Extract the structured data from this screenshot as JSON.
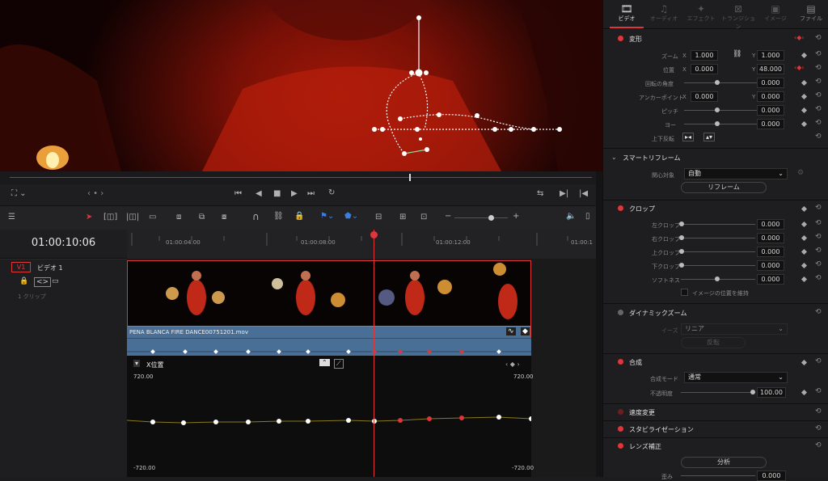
{
  "inspector": {
    "tabs": [
      "ビデオ",
      "オーディオ",
      "エフェクト",
      "トランジション",
      "イメージ",
      "ファイル"
    ],
    "transform": {
      "title": "変形",
      "zoom_label": "ズーム",
      "zoom_x": "1.000",
      "zoom_y": "1.000",
      "pos_label": "位置",
      "pos_x": "0.000",
      "pos_y": "48.000",
      "rot_label": "回転の角度",
      "rot": "0.000",
      "anchor_label": "アンカーポイント",
      "anchor_x": "0.000",
      "anchor_y": "0.000",
      "pitch_label": "ピッチ",
      "pitch": "0.000",
      "yaw_label": "ヨー",
      "yaw": "0.000",
      "flip_label": "上下反転",
      "x": "X",
      "y": "Y"
    },
    "smart": {
      "title": "スマートリフレーム",
      "target_label": "関心対象",
      "target": "自動",
      "btn": "リフレーム"
    },
    "crop": {
      "title": "クロップ",
      "left_label": "左クロップ",
      "left": "0.000",
      "right_label": "右クロップ",
      "right": "0.000",
      "top_label": "上クロップ",
      "top": "0.000",
      "bottom_label": "下クロップ",
      "bottom": "0.000",
      "soft_label": "ソフトネス",
      "soft": "0.000",
      "retain": "イメージの位置を維持"
    },
    "dynzoom": {
      "title": "ダイナミックズーム",
      "ease_label": "イーズ",
      "ease": "リニア",
      "btn": "反転"
    },
    "composite": {
      "title": "合成",
      "mode_label": "合成モード",
      "mode": "通常",
      "opacity_label": "不透明度",
      "opacity": "100.00"
    },
    "speed": {
      "title": "速度変更"
    },
    "stab": {
      "title": "スタビライゼーション"
    },
    "lens": {
      "title": "レンズ補正",
      "btn": "分析",
      "dist_label": "歪み",
      "dist": "0.000"
    }
  },
  "timeline": {
    "timecode": "01:00:10:06",
    "ticks": [
      "01:00:04:00",
      "01:00:08:00",
      "01:00:12:00",
      "01:00:1"
    ],
    "track_label": "V1",
    "track_name": "ビデオ 1",
    "clips_count": "1 クリップ",
    "clip_name": "PENA BLANCA FIRE DANCE00751201.mov",
    "curve_title": "X位置",
    "top_left": "720.00",
    "top_right": "720.00",
    "bottom_left": "-720.00",
    "bottom_right": "-720.00"
  },
  "colors": {
    "accent": "#e0363a",
    "clip": "#4a6f96",
    "playhead": "#e0363a"
  }
}
